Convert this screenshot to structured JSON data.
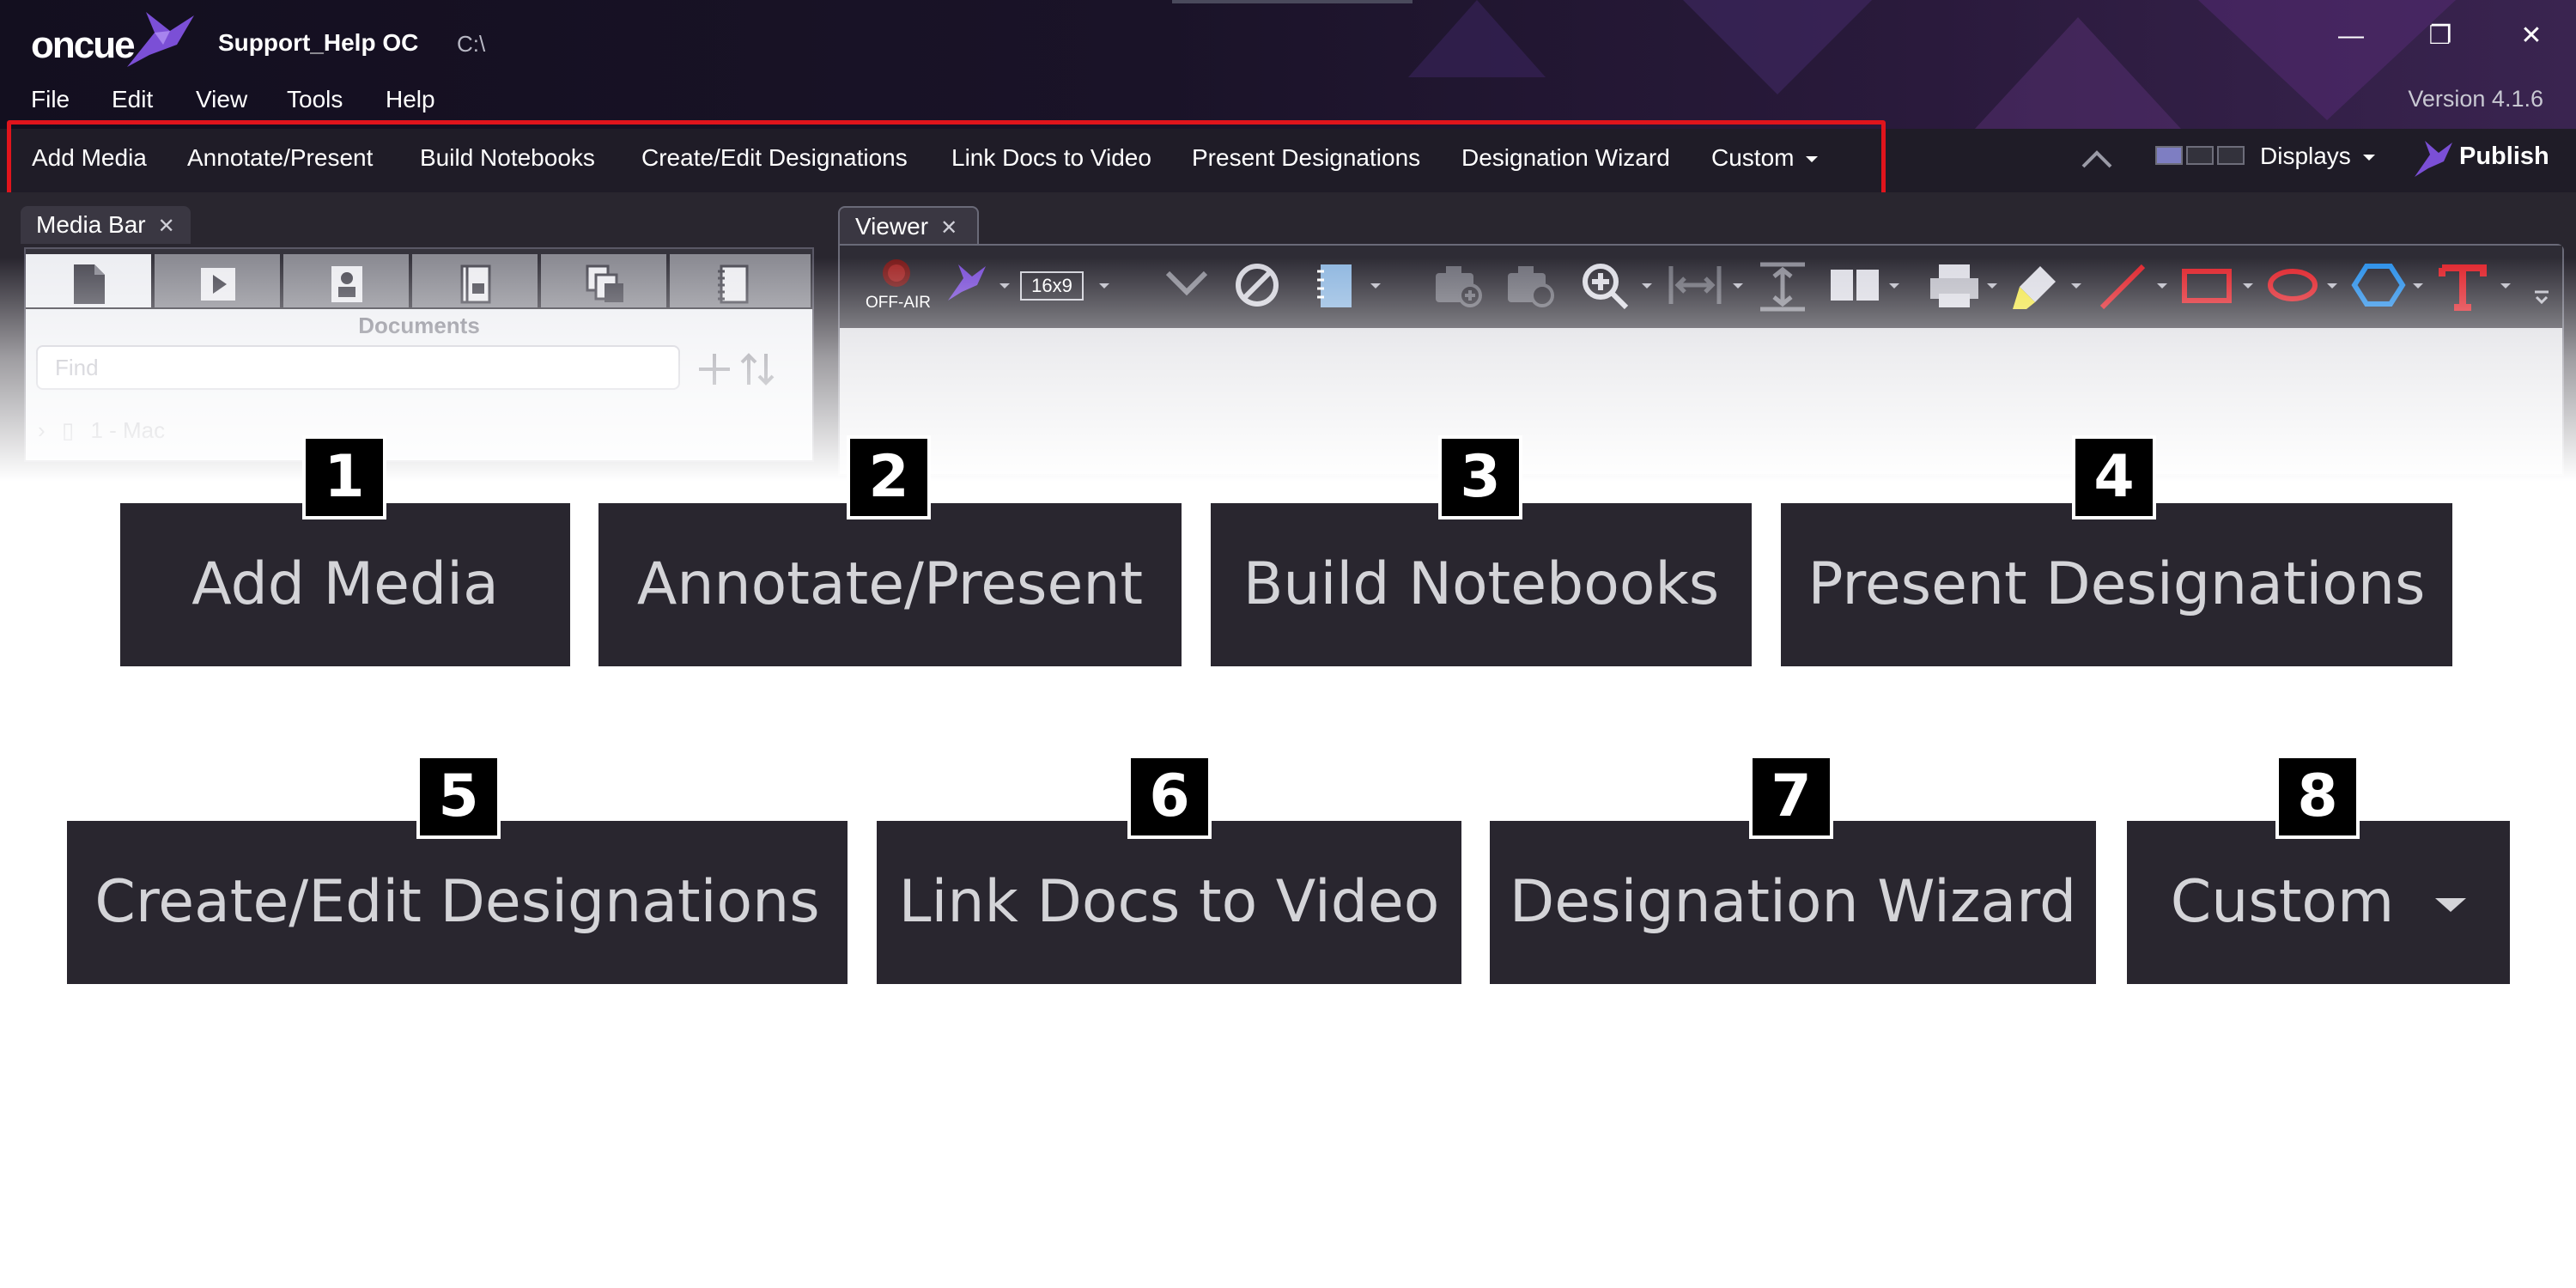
{
  "app": {
    "logo_text": "oncue",
    "document_title": "Support_Help OC",
    "path": "C:\\",
    "version": "Version 4.1.6",
    "window_controls": {
      "minimize": "—",
      "maximize": "❐",
      "close": "✕"
    }
  },
  "menu": [
    "File",
    "Edit",
    "View",
    "Tools",
    "Help"
  ],
  "workflow_bar": {
    "items": [
      "Add Media",
      "Annotate/Present",
      "Build Notebooks",
      "Create/Edit Designations",
      "Link Docs to Video",
      "Present Designations",
      "Designation Wizard",
      "Custom"
    ],
    "displays_label": "Displays",
    "publish_label": "Publish",
    "highlight_color": "#e0141c"
  },
  "media_bar": {
    "tab_label": "Media Bar",
    "section_label": "Documents",
    "find_placeholder": "Find",
    "tree_first_item": "1 - Mac",
    "tabs": [
      "documents-icon",
      "video-icon",
      "witness-icon",
      "notebook-icon",
      "designations-icon",
      "spiral-notebook-icon"
    ]
  },
  "viewer": {
    "tab_label": "Viewer",
    "offair_label": "OFF-AIR",
    "aspect_ratio": "16x9"
  },
  "callouts": [
    {
      "number": "1",
      "label": "Add Media"
    },
    {
      "number": "2",
      "label": "Annotate/Present"
    },
    {
      "number": "3",
      "label": "Build Notebooks"
    },
    {
      "number": "4",
      "label": "Present Designations"
    },
    {
      "number": "5",
      "label": "Create/Edit Designations"
    },
    {
      "number": "6",
      "label": "Link Docs to Video"
    },
    {
      "number": "7",
      "label": "Designation Wizard"
    },
    {
      "number": "8",
      "label": "Custom"
    }
  ],
  "colors": {
    "accent_purple": "#7b4fd6",
    "tile_background": "#29262f",
    "tile_text": "#d4d4d8",
    "badge_background": "#000000"
  }
}
